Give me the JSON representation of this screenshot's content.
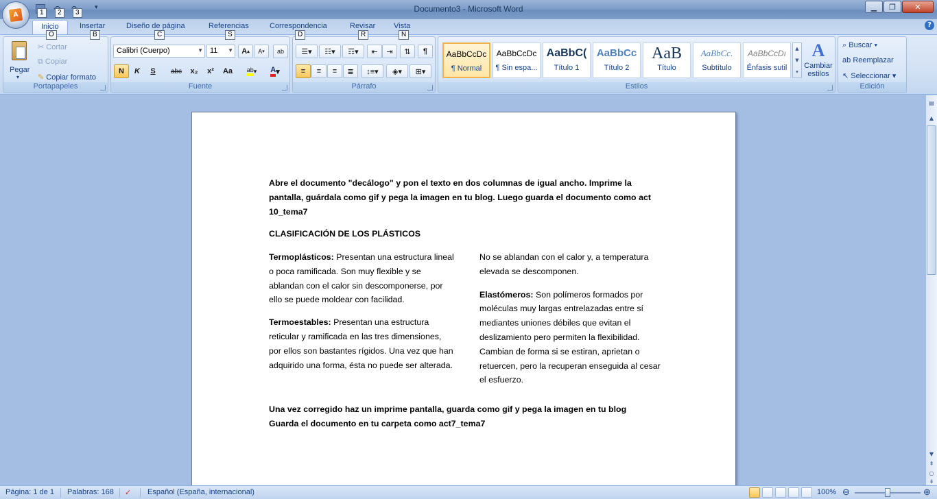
{
  "window": {
    "title": "Documento3 - Microsoft Word"
  },
  "qat": {
    "keytips": [
      "1",
      "2",
      "3"
    ]
  },
  "tabs": [
    {
      "label": "Inicio",
      "keytip": "O"
    },
    {
      "label": "Insertar",
      "keytip": "B"
    },
    {
      "label": "Diseño de página",
      "keytip": "C"
    },
    {
      "label": "Referencias",
      "keytip": "S"
    },
    {
      "label": "Correspondencia",
      "keytip": "D"
    },
    {
      "label": "Revisar",
      "keytip": "R"
    },
    {
      "label": "Vista",
      "keytip": "N"
    }
  ],
  "ribbon": {
    "clipboard": {
      "title": "Portapapeles",
      "paste": "Pegar",
      "cut": "Cortar",
      "copy": "Copiar",
      "format_painter": "Copiar formato"
    },
    "font": {
      "title": "Fuente",
      "font_name": "Calibri (Cuerpo)",
      "font_size": "11",
      "bold": "N",
      "italic": "K",
      "underline": "S",
      "strike": "abc",
      "subscript": "x₂",
      "superscript": "x²",
      "case": "Aa",
      "grow": "A",
      "shrink": "A"
    },
    "paragraph": {
      "title": "Párrafo"
    },
    "styles": {
      "title": "Estilos",
      "items": [
        {
          "sample": "AaBbCcDc",
          "name": "¶ Normal"
        },
        {
          "sample": "AaBbCcDc",
          "name": "¶ Sin espa..."
        },
        {
          "sample": "AaBbC(",
          "name": "Título 1"
        },
        {
          "sample": "AaBbCc",
          "name": "Título 2"
        },
        {
          "sample": "AaB",
          "name": "Título"
        },
        {
          "sample": "AaBbCc.",
          "name": "Subtítulo"
        },
        {
          "sample": "AaBbCcDı",
          "name": "Énfasis sutil"
        }
      ],
      "change_styles": "Cambiar estilos"
    },
    "editing": {
      "title": "Edición",
      "find": "Buscar",
      "replace": "Reemplazar",
      "select": "Seleccionar"
    }
  },
  "document": {
    "intro": "Abre el documento \"decálogo\" y pon el texto en dos columnas de igual ancho. Imprime la pantalla, guárdala como gif y pega la imagen en tu blog. Luego guarda el documento como act 10_tema7",
    "heading": "CLASIFICACIÓN DE LOS PLÁSTICOS",
    "termo_title": "Termoplásticos:",
    "termo_text": " Presentan una estructura lineal o poca ramificada. Son muy flexible y se ablandan con el calor sin descomponerse, por ello se puede moldear con facilidad.",
    "termoest_title": "Termoestables:",
    "termoest_text": " Presentan una estructura reticular y ramificada en las tres dimensiones, por ellos son bastantes rígidos. Una vez que han adquirido una forma, ésta no puede ser alterada.",
    "col2_top": "No se ablandan con el calor y, a temperatura elevada se descomponen.",
    "elast_title": "Elastómeros:",
    "elast_text": " Son polímeros formados por moléculas muy largas entrelazadas entre sí mediantes uniones débiles que evitan el deslizamiento pero permiten la flexibilidad. Cambian de forma si se estiran, aprietan o retuercen, pero la recuperan enseguida al cesar el esfuerzo.",
    "footer1": "Una vez corregido haz un imprime pantalla, guarda como gif y pega la imagen en tu blog",
    "footer2": "Guarda el documento en tu carpeta como act7_tema7"
  },
  "status": {
    "page": "Página: 1 de 1",
    "words": "Palabras: 168",
    "language": "Español (España, internacional)",
    "zoom": "100%"
  }
}
